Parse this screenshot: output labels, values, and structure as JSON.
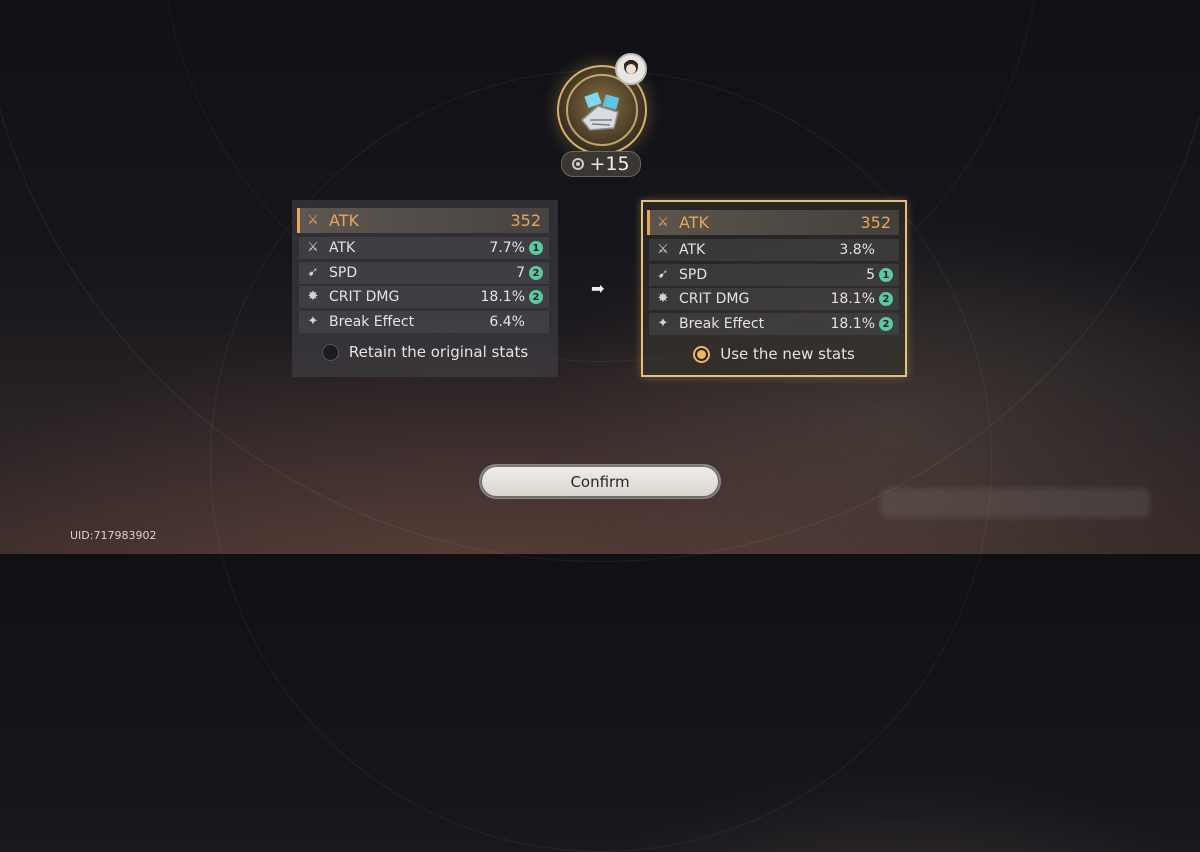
{
  "relic": {
    "level": "+15"
  },
  "left_panel": {
    "main_stat": {
      "name": "ATK",
      "value": "352"
    },
    "sub_stats": [
      {
        "icon": "atk-icon",
        "name": "ATK",
        "value": "7.7%",
        "rolls": "1"
      },
      {
        "icon": "spd-icon",
        "name": "SPD",
        "value": "7",
        "rolls": "2"
      },
      {
        "icon": "crit-dmg-icon",
        "name": "CRIT DMG",
        "value": "18.1%",
        "rolls": "2"
      },
      {
        "icon": "break-effect-icon",
        "name": "Break Effect",
        "value": "6.4%",
        "rolls": ""
      }
    ],
    "option_label": "Retain the original stats",
    "selected": false
  },
  "right_panel": {
    "main_stat": {
      "name": "ATK",
      "value": "352"
    },
    "sub_stats": [
      {
        "icon": "atk-icon",
        "name": "ATK",
        "value": "3.8%",
        "rolls": ""
      },
      {
        "icon": "spd-icon",
        "name": "SPD",
        "value": "5",
        "rolls": "1"
      },
      {
        "icon": "crit-dmg-icon",
        "name": "CRIT DMG",
        "value": "18.1%",
        "rolls": "2"
      },
      {
        "icon": "break-effect-icon",
        "name": "Break Effect",
        "value": "18.1%",
        "rolls": "2"
      }
    ],
    "option_label": "Use the new stats",
    "selected": true
  },
  "confirm_label": "Confirm",
  "uid": "UID:717983902",
  "colors": {
    "accent_gold": "#e9a65a",
    "roll_badge": "#5fc8a0",
    "selected_border": "#e2c07a"
  }
}
